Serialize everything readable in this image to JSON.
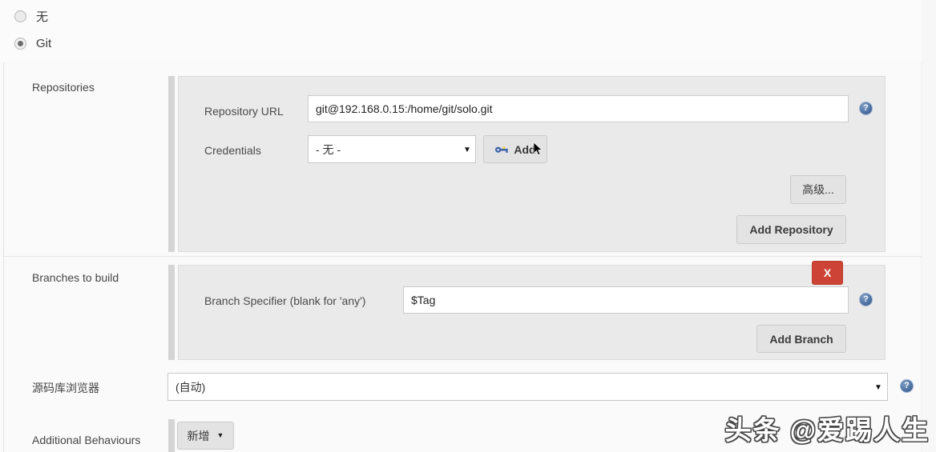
{
  "scm": {
    "options": [
      {
        "label": "无",
        "selected": false
      },
      {
        "label": "Git",
        "selected": true
      }
    ]
  },
  "repositories": {
    "row_label": "Repositories",
    "repository_url": {
      "label": "Repository URL",
      "value": "git@192.168.0.15:/home/git/solo.git"
    },
    "credentials": {
      "label": "Credentials",
      "selected": "- 无 -",
      "caret": "▼",
      "add_button": "Add"
    },
    "advanced_button": "高级...",
    "add_repository_button": "Add Repository"
  },
  "branches": {
    "row_label": "Branches to build",
    "delete_button": "X",
    "branch_specifier": {
      "label": "Branch Specifier (blank for 'any')",
      "value": "$Tag"
    },
    "add_branch_button": "Add Branch"
  },
  "repo_browser": {
    "row_label": "源码库浏览器",
    "selected": "(自动)",
    "caret": "▼"
  },
  "additional_behaviours": {
    "row_label": "Additional Behaviours",
    "add_button": "新增",
    "caret": "▼"
  },
  "help": {
    "glyph": "?"
  },
  "watermark": {
    "text": "头条 @爱踢人生"
  },
  "colors": {
    "page_background": "#fafafa",
    "panel_background": "#eaeaea",
    "accent_bar": "#d4d4d4",
    "danger": "#cd4436",
    "help_blue": "#4f74a6",
    "input_border": "#cccccc"
  }
}
